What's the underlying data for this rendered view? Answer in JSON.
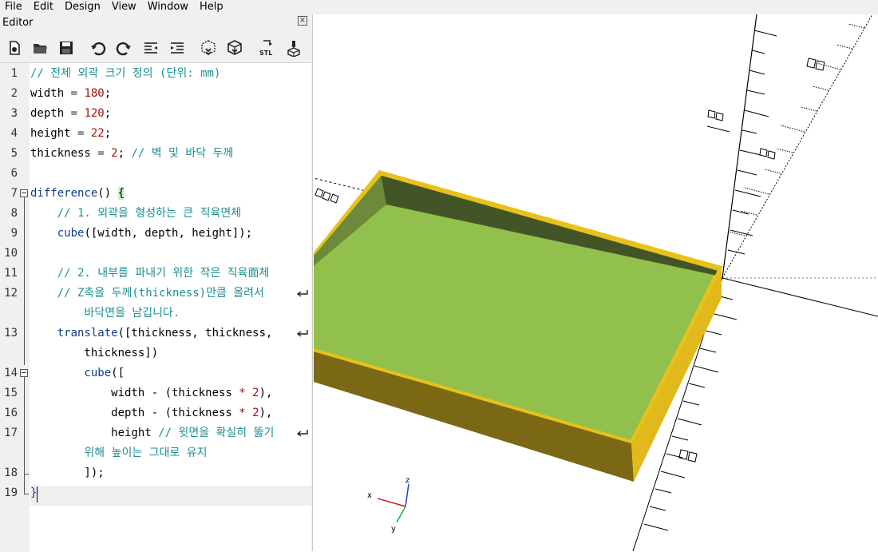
{
  "menu": [
    "File",
    "Edit",
    "Design",
    "View",
    "Window",
    "Help"
  ],
  "editor": {
    "title": "Editor",
    "close_glyph": "×",
    "toolbar": [
      {
        "name": "new-file-icon"
      },
      {
        "name": "open-file-icon"
      },
      {
        "name": "save-icon"
      },
      {
        "name": "undo-icon"
      },
      {
        "name": "redo-icon"
      },
      {
        "name": "unindent-icon"
      },
      {
        "name": "indent-icon"
      },
      {
        "name": "preview-icon"
      },
      {
        "name": "render-icon"
      },
      {
        "name": "export-stl-icon"
      },
      {
        "name": "3d-print-icon"
      }
    ],
    "stl_label": "STL",
    "line_numbers": [
      "1",
      "2",
      "3",
      "4",
      "5",
      "6",
      "7",
      "8",
      "9",
      "10",
      "11",
      "12",
      "13",
      "14",
      "15",
      "16",
      "17",
      "18",
      "19"
    ]
  },
  "code": {
    "l1": "// 전체 외곽 크기 정의 (단위: mm)",
    "l2a": "width",
    "l2b": " = ",
    "l2c": "180",
    "l2d": ";",
    "l3a": "depth",
    "l3b": " = ",
    "l3c": "120",
    "l3d": ";",
    "l4a": "height",
    "l4b": " = ",
    "l4c": "22",
    "l4d": ";",
    "l5a": "thickness",
    "l5b": " = ",
    "l5c": "2",
    "l5d": "; ",
    "l5e": "// 벽 및 바닥 두께",
    "l7a": "difference",
    "l7b": "() ",
    "l7c": "{",
    "l8": "    // 1. 외곽을 형성하는 큰 직육면체",
    "l9a": "    cube",
    "l9b": "([width, depth, height]);",
    "l11": "    // 2. 내부를 파내기 위한 작은 직육面체",
    "l12a": "    // Z축을 두께(thickness)만큼 올려서",
    "l12b": "        바닥면을 남깁니다.",
    "l13a": "    translate",
    "l13b": "([thickness, thickness,",
    "l13c": "        thickness])",
    "l14a": "        cube",
    "l14b": "([",
    "l15a": "            width - (thickness ",
    "l15b": "*",
    "l15c": " ",
    "l15d": "2",
    "l15e": "),",
    "l16a": "            depth - (thickness ",
    "l16b": "*",
    "l16c": " ",
    "l16d": "2",
    "l16e": "),",
    "l17a": "            height ",
    "l17b": "// 윗면을 확실히 뚫기",
    "l17c": "        위해 높이는 그대로 유지",
    "l18": "        ]);",
    "l19": "}"
  },
  "viewport": {
    "axis_labels": {
      "x": "x",
      "y": "y",
      "z": "z"
    },
    "colors": {
      "box_top": "#e8c21a",
      "box_inner_floor": "#92c04c",
      "box_inner_wall_dark": "#435526",
      "box_inner_wall_mid": "#6c8a3a",
      "box_outer_front": "#7a6814",
      "box_outer_side": "#e2b91c"
    }
  }
}
